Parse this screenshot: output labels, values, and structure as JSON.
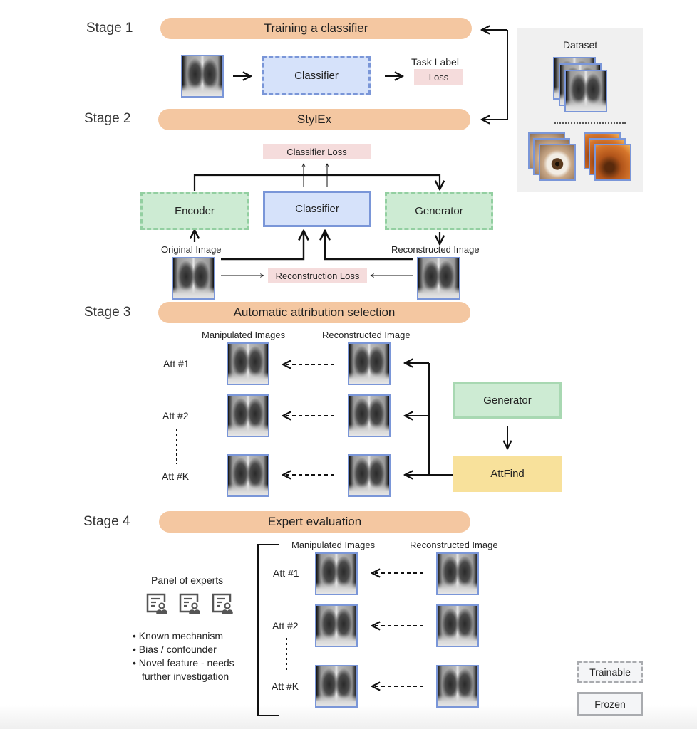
{
  "stages": [
    {
      "label": "Stage 1",
      "title": "Training a classifier"
    },
    {
      "label": "Stage 2",
      "title": "StylEx"
    },
    {
      "label": "Stage 3",
      "title": "Automatic attribution selection"
    },
    {
      "label": "Stage 4",
      "title": "Expert evaluation"
    }
  ],
  "stage1": {
    "classifier": "Classifier",
    "task_label": "Task Label",
    "loss": "Loss"
  },
  "dataset": {
    "title": "Dataset",
    "image_types": [
      "chest-xray",
      "external-eye",
      "fundus"
    ]
  },
  "stage2": {
    "classifier_loss": "Classifier Loss",
    "encoder": "Encoder",
    "classifier": "Classifier",
    "generator": "Generator",
    "original_image": "Original Image",
    "reconstructed_image": "Reconstructed Image",
    "reconstruction_loss": "Reconstruction Loss"
  },
  "stage3": {
    "manipulated_images": "Manipulated Images",
    "reconstructed_image": "Reconstructed Image",
    "attributes": [
      "Att #1",
      "Att #2",
      "Att #K"
    ],
    "generator": "Generator",
    "attfind": "AttFind"
  },
  "stage4": {
    "manipulated_images": "Manipulated Images",
    "reconstructed_image": "Reconstructed Image",
    "attributes": [
      "Att #1",
      "Att #2",
      "Att #K"
    ],
    "panel_title": "Panel of experts",
    "bullets": [
      "Known mechanism",
      "Bias / confounder",
      "Novel feature - needs",
      "further investigation"
    ]
  },
  "legend": {
    "trainable": "Trainable",
    "frozen": "Frozen"
  },
  "colors": {
    "stage_bar": "#f4c7a1",
    "classifier_fill": "#d6e2fa",
    "classifier_border": "#7a96d8",
    "green_fill": "#cdebd3",
    "green_border": "#93cfa1",
    "attfind_fill": "#f8e19b",
    "loss_fill": "#f5dcdc",
    "dataset_panel": "#f0f0f0"
  }
}
